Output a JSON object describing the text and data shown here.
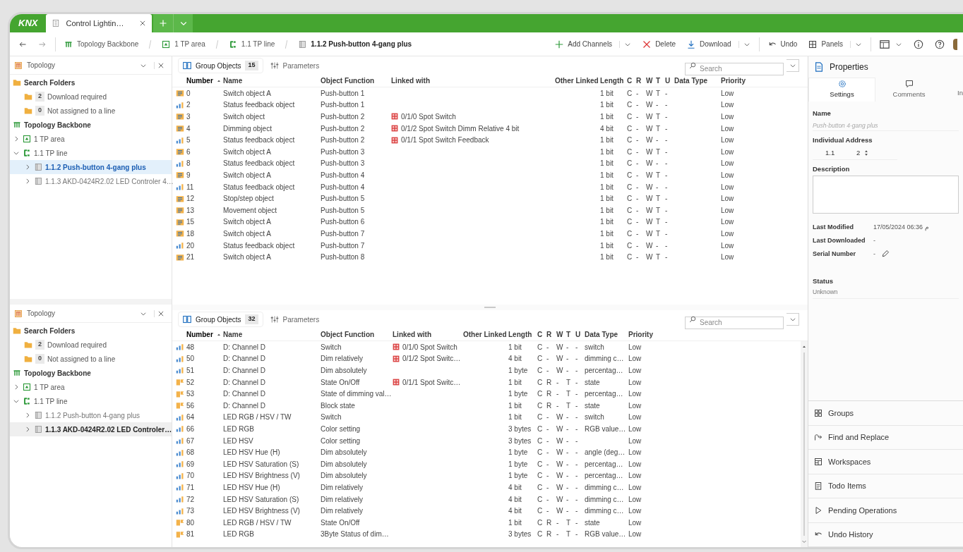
{
  "window": {
    "logo": "KNX",
    "tab": "Control Lightin…"
  },
  "breadcrumb": [
    {
      "label": "Topology Backbone",
      "kind": "backbone",
      "selected": false
    },
    {
      "label": "1 TP area",
      "kind": "area",
      "selected": false
    },
    {
      "label": "1.1 TP line",
      "kind": "line",
      "selected": false
    },
    {
      "label": "1.1.2 Push-button 4-gang plus",
      "kind": "device",
      "selected": true
    }
  ],
  "toolbar": [
    {
      "label": "Add Channels",
      "kind": "add",
      "dropdown": true
    },
    {
      "label": "Delete",
      "kind": "delete",
      "dropdown": false
    },
    {
      "label": "Download",
      "kind": "download",
      "dropdown": true
    },
    {
      "label": "Undo",
      "kind": "undo",
      "dropdown": false
    },
    {
      "label": "Panels",
      "kind": "panels",
      "dropdown": true
    }
  ],
  "panes": [
    {
      "topology": {
        "title": "Topology",
        "active": true,
        "tree": [
          {
            "label": "Search Folders",
            "kind": "search",
            "children": [
              {
                "label": "Download required",
                "kind": "folder",
                "count": "2"
              },
              {
                "label": "Not assigned to a line",
                "kind": "folder",
                "count": "0"
              }
            ]
          },
          {
            "label": "Topology Backbone",
            "kind": "backbone"
          },
          {
            "label": "1 TP area",
            "kind": "area",
            "expanded": false
          },
          {
            "label": "1.1 TP line",
            "kind": "line",
            "expanded": true,
            "children": [
              {
                "label": "1.1.2 Push-button 4-gang plus",
                "kind": "device",
                "expanded": false,
                "selected": true
              },
              {
                "label": "1.1.3 AKD-0424R2.02 LED Controler 4…",
                "kind": "device",
                "expanded": false,
                "selected": false
              }
            ]
          }
        ]
      },
      "objects": {
        "tabs": [
          {
            "label": "Group Objects",
            "count": "15",
            "kind": "objects",
            "selected": true
          },
          {
            "label": "Parameters",
            "kind": "parameters",
            "selected": false
          }
        ],
        "search": {
          "placeholder": "Search"
        },
        "columns": [
          {
            "label": "Number",
            "sorted": true
          },
          {
            "label": "Name",
            "sorted": false
          },
          {
            "label": "Object Function",
            "sorted": false
          },
          {
            "label": "Linked with",
            "sorted": false
          },
          {
            "label": "Other Linked",
            "sorted": false
          },
          {
            "label": "Length",
            "sorted": false
          },
          {
            "label": "C",
            "sorted": false
          },
          {
            "label": "R",
            "sorted": false
          },
          {
            "label": "W",
            "sorted": false
          },
          {
            "label": "T",
            "sorted": false
          },
          {
            "label": "U",
            "sorted": false
          },
          {
            "label": "Data Type",
            "sorted": false
          },
          {
            "label": "Priority",
            "sorted": false
          }
        ],
        "rows": [
          {
            "kind": "control",
            "number": "0",
            "name": "Switch object A",
            "function": "Push-button 1",
            "length": "1 bit",
            "c": "C",
            "r": "-",
            "w": "W",
            "t": "T",
            "u": "-",
            "priority": "Low"
          },
          {
            "kind": "status",
            "number": "2",
            "name": "Status feedback object",
            "function": "Push-button 1",
            "length": "1 bit",
            "c": "C",
            "r": "-",
            "w": "W",
            "t": "-",
            "u": "-",
            "priority": "Low"
          },
          {
            "kind": "control",
            "number": "3",
            "name": "Switch object",
            "function": "Push-button 2",
            "linked": "0/1/0 Spot Switch",
            "length": "1 bit",
            "c": "C",
            "r": "-",
            "w": "W",
            "t": "T",
            "u": "-",
            "priority": "Low"
          },
          {
            "kind": "control",
            "number": "4",
            "name": "Dimming object",
            "function": "Push-button 2",
            "linked": "0/1/2 Spot Switch Dimm Relative 4 bit",
            "length": "4 bit",
            "c": "C",
            "r": "-",
            "w": "W",
            "t": "T",
            "u": "-",
            "priority": "Low"
          },
          {
            "kind": "status",
            "number": "5",
            "name": "Status feedback object",
            "function": "Push-button 2",
            "linked": "0/1/1 Spot Switch Feedback",
            "length": "1 bit",
            "c": "C",
            "r": "-",
            "w": "W",
            "t": "-",
            "u": "-",
            "priority": "Low"
          },
          {
            "kind": "control",
            "number": "6",
            "name": "Switch object A",
            "function": "Push-button 3",
            "length": "1 bit",
            "c": "C",
            "r": "-",
            "w": "W",
            "t": "T",
            "u": "-",
            "priority": "Low"
          },
          {
            "kind": "status",
            "number": "8",
            "name": "Status feedback object",
            "function": "Push-button 3",
            "length": "1 bit",
            "c": "C",
            "r": "-",
            "w": "W",
            "t": "-",
            "u": "-",
            "priority": "Low"
          },
          {
            "kind": "control",
            "number": "9",
            "name": "Switch object A",
            "function": "Push-button 4",
            "length": "1 bit",
            "c": "C",
            "r": "-",
            "w": "W",
            "t": "T",
            "u": "-",
            "priority": "Low"
          },
          {
            "kind": "status",
            "number": "11",
            "name": "Status feedback object",
            "function": "Push-button 4",
            "length": "1 bit",
            "c": "C",
            "r": "-",
            "w": "W",
            "t": "-",
            "u": "-",
            "priority": "Low"
          },
          {
            "kind": "control",
            "number": "12",
            "name": "Stop/step object",
            "function": "Push-button 5",
            "length": "1 bit",
            "c": "C",
            "r": "-",
            "w": "W",
            "t": "T",
            "u": "-",
            "priority": "Low"
          },
          {
            "kind": "control",
            "number": "13",
            "name": "Movement object",
            "function": "Push-button 5",
            "length": "1 bit",
            "c": "C",
            "r": "-",
            "w": "W",
            "t": "T",
            "u": "-",
            "priority": "Low"
          },
          {
            "kind": "control",
            "number": "15",
            "name": "Switch object A",
            "function": "Push-button 6",
            "length": "1 bit",
            "c": "C",
            "r": "-",
            "w": "W",
            "t": "T",
            "u": "-",
            "priority": "Low"
          },
          {
            "kind": "control",
            "number": "18",
            "name": "Switch object A",
            "function": "Push-button 7",
            "length": "1 bit",
            "c": "C",
            "r": "-",
            "w": "W",
            "t": "T",
            "u": "-",
            "priority": "Low"
          },
          {
            "kind": "status",
            "number": "20",
            "name": "Status feedback object",
            "function": "Push-button 7",
            "length": "1 bit",
            "c": "C",
            "r": "-",
            "w": "W",
            "t": "-",
            "u": "-",
            "priority": "Low"
          },
          {
            "kind": "control",
            "number": "21",
            "name": "Switch object A",
            "function": "Push-button 8",
            "length": "1 bit",
            "c": "C",
            "r": "-",
            "w": "W",
            "t": "T",
            "u": "-",
            "priority": "Low"
          }
        ]
      }
    },
    {
      "topology": {
        "title": "Topology",
        "active": false,
        "tree": [
          {
            "label": "Search Folders",
            "kind": "search",
            "children": [
              {
                "label": "Download required",
                "kind": "folder",
                "count": "2"
              },
              {
                "label": "Not assigned to a line",
                "kind": "folder",
                "count": "0"
              }
            ]
          },
          {
            "label": "Topology Backbone",
            "kind": "backbone"
          },
          {
            "label": "1 TP area",
            "kind": "area",
            "expanded": false
          },
          {
            "label": "1.1 TP line",
            "kind": "line",
            "expanded": true,
            "children": [
              {
                "label": "1.1.2 Push-button 4-gang plus",
                "kind": "device",
                "expanded": false,
                "selected": false
              },
              {
                "label": "1.1.3 AKD-0424R2.02 LED Controler…",
                "kind": "device",
                "expanded": false,
                "selected": true
              }
            ]
          }
        ]
      },
      "objects": {
        "tabs": [
          {
            "label": "Group Objects",
            "count": "32",
            "kind": "objects",
            "selected": true
          },
          {
            "label": "Parameters",
            "kind": "parameters",
            "selected": false
          }
        ],
        "search": {
          "placeholder": "Search"
        },
        "columns": [
          {
            "label": "Number",
            "sorted": true
          },
          {
            "label": "Name",
            "sorted": false
          },
          {
            "label": "Object Function",
            "sorted": false
          },
          {
            "label": "Linked with",
            "sorted": false
          },
          {
            "label": "Other Linked",
            "sorted": false
          },
          {
            "label": "Length",
            "sorted": false
          },
          {
            "label": "C",
            "sorted": false
          },
          {
            "label": "R",
            "sorted": false
          },
          {
            "label": "W",
            "sorted": false
          },
          {
            "label": "T",
            "sorted": false
          },
          {
            "label": "U",
            "sorted": false
          },
          {
            "label": "Data Type",
            "sorted": false
          },
          {
            "label": "Priority",
            "sorted": false
          }
        ],
        "rows": [
          {
            "kind": "status",
            "number": "48",
            "name": "D: Channel D",
            "function": "Switch",
            "linked": "0/1/0 Spot Switch",
            "length": "1 bit",
            "c": "C",
            "r": "-",
            "w": "W",
            "t": "-",
            "u": "-",
            "type": "switch",
            "priority": "Low"
          },
          {
            "kind": "status",
            "number": "50",
            "name": "D: Channel D",
            "function": "Dim relatively",
            "linked": "0/1/2 Spot Switc…",
            "length": "4 bit",
            "c": "C",
            "r": "-",
            "w": "W",
            "t": "-",
            "u": "-",
            "type": "dimming c…",
            "priority": "Low"
          },
          {
            "kind": "status",
            "number": "51",
            "name": "D: Channel D",
            "function": "Dim absolutely",
            "length": "1 byte",
            "c": "C",
            "r": "-",
            "w": "W",
            "t": "-",
            "u": "-",
            "type": "percentag…",
            "priority": "Low"
          },
          {
            "kind": "state",
            "number": "52",
            "name": "D: Channel D",
            "function": "State On/Off",
            "linked": "0/1/1 Spot Switc…",
            "length": "1 bit",
            "c": "C",
            "r": "R",
            "w": "-",
            "t": "T",
            "u": "-",
            "type": "state",
            "priority": "Low"
          },
          {
            "kind": "state",
            "number": "53",
            "name": "D: Channel D",
            "function": "State of dimming val…",
            "length": "1 byte",
            "c": "C",
            "r": "R",
            "w": "-",
            "t": "T",
            "u": "-",
            "type": "percentag…",
            "priority": "Low"
          },
          {
            "kind": "state",
            "number": "56",
            "name": "D: Channel D",
            "function": "Block state",
            "length": "1 bit",
            "c": "C",
            "r": "R",
            "w": "-",
            "t": "T",
            "u": "-",
            "type": "state",
            "priority": "Low"
          },
          {
            "kind": "status",
            "number": "64",
            "name": "LED RGB / HSV / TW",
            "function": "Switch",
            "length": "1 bit",
            "c": "C",
            "r": "-",
            "w": "W",
            "t": "-",
            "u": "-",
            "type": "switch",
            "priority": "Low"
          },
          {
            "kind": "status",
            "number": "66",
            "name": "LED RGB",
            "function": "Color setting",
            "length": "3 bytes",
            "c": "C",
            "r": "-",
            "w": "W",
            "t": "-",
            "u": "-",
            "type": "RGB value…",
            "priority": "Low"
          },
          {
            "kind": "status",
            "number": "67",
            "name": "LED HSV",
            "function": "Color setting",
            "length": "3 bytes",
            "c": "C",
            "r": "-",
            "w": "W",
            "t": "-",
            "u": "-",
            "priority": "Low"
          },
          {
            "kind": "status",
            "number": "68",
            "name": "LED HSV Hue (H)",
            "function": "Dim absolutely",
            "length": "1 byte",
            "c": "C",
            "r": "-",
            "w": "W",
            "t": "-",
            "u": "-",
            "type": "angle (deg…",
            "priority": "Low"
          },
          {
            "kind": "status",
            "number": "69",
            "name": "LED HSV Saturation (S)",
            "function": "Dim absolutely",
            "length": "1 byte",
            "c": "C",
            "r": "-",
            "w": "W",
            "t": "-",
            "u": "-",
            "type": "percentag…",
            "priority": "Low"
          },
          {
            "kind": "status",
            "number": "70",
            "name": "LED HSV Brightness (V)",
            "function": "Dim absolutely",
            "length": "1 byte",
            "c": "C",
            "r": "-",
            "w": "W",
            "t": "-",
            "u": "-",
            "type": "percentag…",
            "priority": "Low"
          },
          {
            "kind": "status",
            "number": "71",
            "name": "LED HSV Hue (H)",
            "function": "Dim relatively",
            "length": "4 bit",
            "c": "C",
            "r": "-",
            "w": "W",
            "t": "-",
            "u": "-",
            "type": "dimming c…",
            "priority": "Low"
          },
          {
            "kind": "status",
            "number": "72",
            "name": "LED HSV Saturation (S)",
            "function": "Dim relatively",
            "length": "4 bit",
            "c": "C",
            "r": "-",
            "w": "W",
            "t": "-",
            "u": "-",
            "type": "dimming c…",
            "priority": "Low"
          },
          {
            "kind": "status",
            "number": "73",
            "name": "LED HSV Brightness (V)",
            "function": "Dim relatively",
            "length": "4 bit",
            "c": "C",
            "r": "-",
            "w": "W",
            "t": "-",
            "u": "-",
            "type": "dimming c…",
            "priority": "Low"
          },
          {
            "kind": "state",
            "number": "80",
            "name": "LED RGB / HSV / TW",
            "function": "State On/Off",
            "length": "1 bit",
            "c": "C",
            "r": "R",
            "w": "-",
            "t": "T",
            "u": "-",
            "type": "state",
            "priority": "Low"
          },
          {
            "kind": "state",
            "number": "81",
            "name": "LED RGB",
            "function": "3Byte Status of dim…",
            "length": "3 bytes",
            "c": "C",
            "r": "R",
            "w": "-",
            "t": "T",
            "u": "-",
            "type": "RGB value…",
            "priority": "Low"
          }
        ]
      }
    }
  ],
  "properties": {
    "title": "Properties",
    "tabs": [
      {
        "label": "Settings",
        "kind": "settings",
        "selected": true
      },
      {
        "label": "Comments",
        "kind": "comments",
        "selected": false
      },
      {
        "label": "In",
        "kind": "info",
        "selected": false
      }
    ],
    "name": {
      "label": "Name",
      "placeholder": "Push-button 4-gang plus"
    },
    "address": {
      "label": "Individual Address",
      "line": "1.1",
      "device": "2"
    },
    "description": {
      "label": "Description"
    },
    "info": [
      {
        "label": "Last Modified",
        "value": "17/05/2024 06:36 م",
        "editable": false
      },
      {
        "label": "Last Downloaded",
        "value": "-",
        "editable": false
      },
      {
        "label": "Serial Number",
        "value": "-",
        "editable": true
      }
    ],
    "status": {
      "label": "Status",
      "value": "Unknown"
    }
  },
  "side_panels": [
    {
      "label": "Groups",
      "kind": "groups"
    },
    {
      "label": "Find and Replace",
      "kind": "find"
    },
    {
      "label": "Workspaces",
      "kind": "workspaces"
    },
    {
      "label": "Todo Items",
      "kind": "todo"
    },
    {
      "label": "Pending Operations",
      "kind": "pending"
    },
    {
      "label": "Undo History",
      "kind": "undo"
    }
  ]
}
